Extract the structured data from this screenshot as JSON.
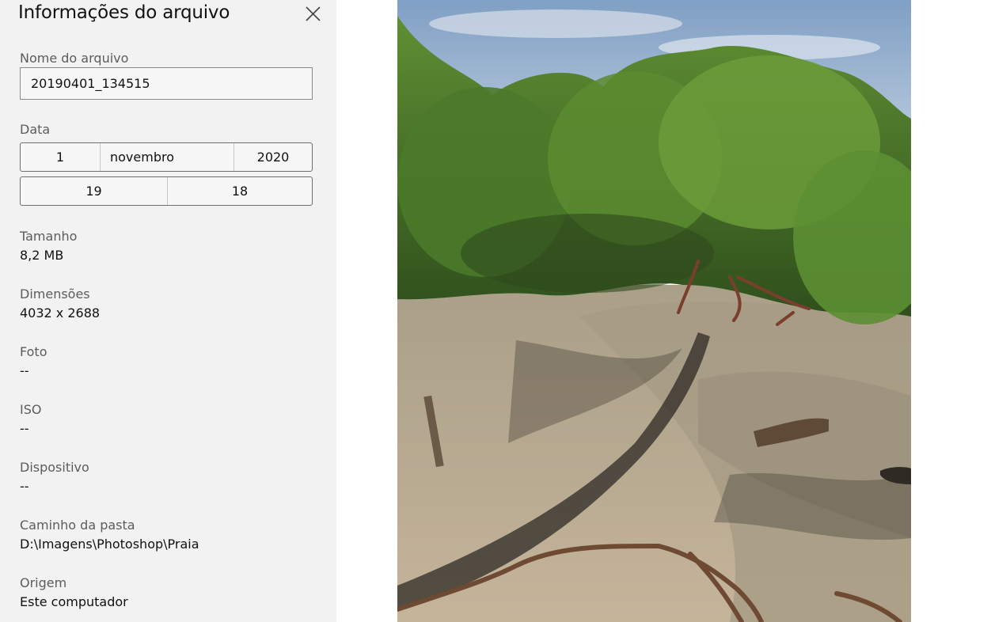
{
  "panel": {
    "title": "Informações do arquivo",
    "close_icon": "close-icon",
    "file_name": {
      "label": "Nome do arquivo",
      "value": "20190401_134515"
    },
    "date": {
      "label": "Data",
      "day": "1",
      "month": "novembro",
      "year": "2020",
      "hour": "19",
      "minute": "18"
    },
    "size": {
      "label": "Tamanho",
      "value": "8,2 MB"
    },
    "dimensions": {
      "label": "Dimensões",
      "value": "4032 x 2688"
    },
    "photo": {
      "label": "Foto",
      "value": "--"
    },
    "iso": {
      "label": "ISO",
      "value": "--"
    },
    "device": {
      "label": "Dispositivo",
      "value": "--"
    },
    "folder_path": {
      "label": "Caminho da pasta",
      "value": "D:\\Imagens\\Photoshop\\Praia"
    },
    "origin": {
      "label": "Origem",
      "value": "Este computador"
    }
  },
  "colors": {
    "panel_bg": "#f2f2f2",
    "label": "#5c5c5c",
    "text": "#111111",
    "sky": "#9fb9d6",
    "foliage": "#4e7d2a",
    "sand": "#b9ab93",
    "water": "#a79c86"
  }
}
